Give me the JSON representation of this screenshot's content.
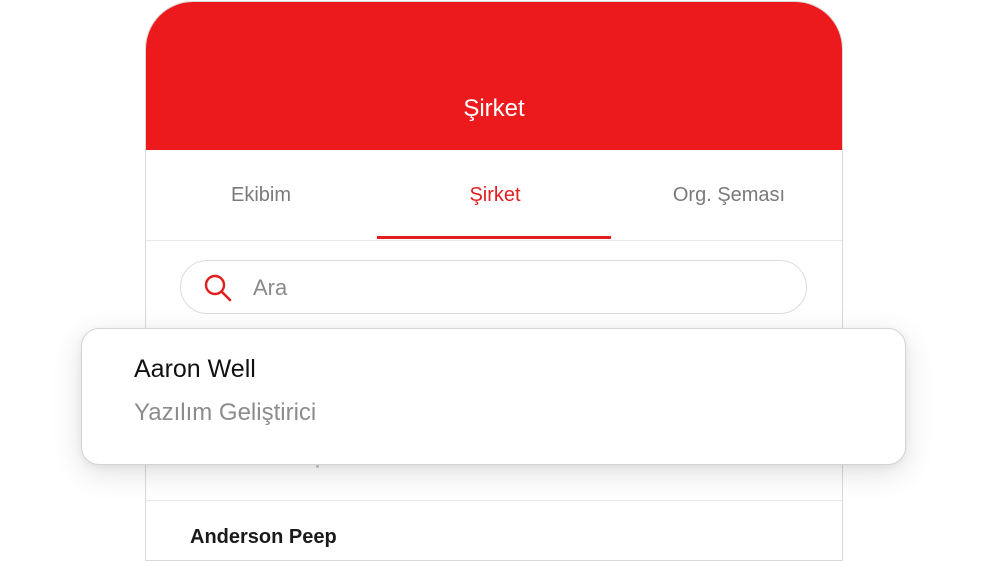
{
  "header": {
    "title": "Şirket"
  },
  "tabs": [
    {
      "label": "Ekibim",
      "active": false
    },
    {
      "label": "Şirket",
      "active": true
    },
    {
      "label": "Org. Şeması",
      "active": false
    }
  ],
  "search": {
    "placeholder": "Ara",
    "value": "",
    "icon": "search-icon"
  },
  "popup_card": {
    "name": "Aaron Well",
    "role": "Yazılım Geliştirici"
  },
  "list": {
    "items": [
      {
        "name": "Anderson Peep"
      }
    ]
  },
  "colors": {
    "brand_red": "#ec1a1c",
    "active_tab": "#e21d1e",
    "inactive_tab": "#7a7a7a",
    "secondary_text": "#8c8c8c"
  }
}
